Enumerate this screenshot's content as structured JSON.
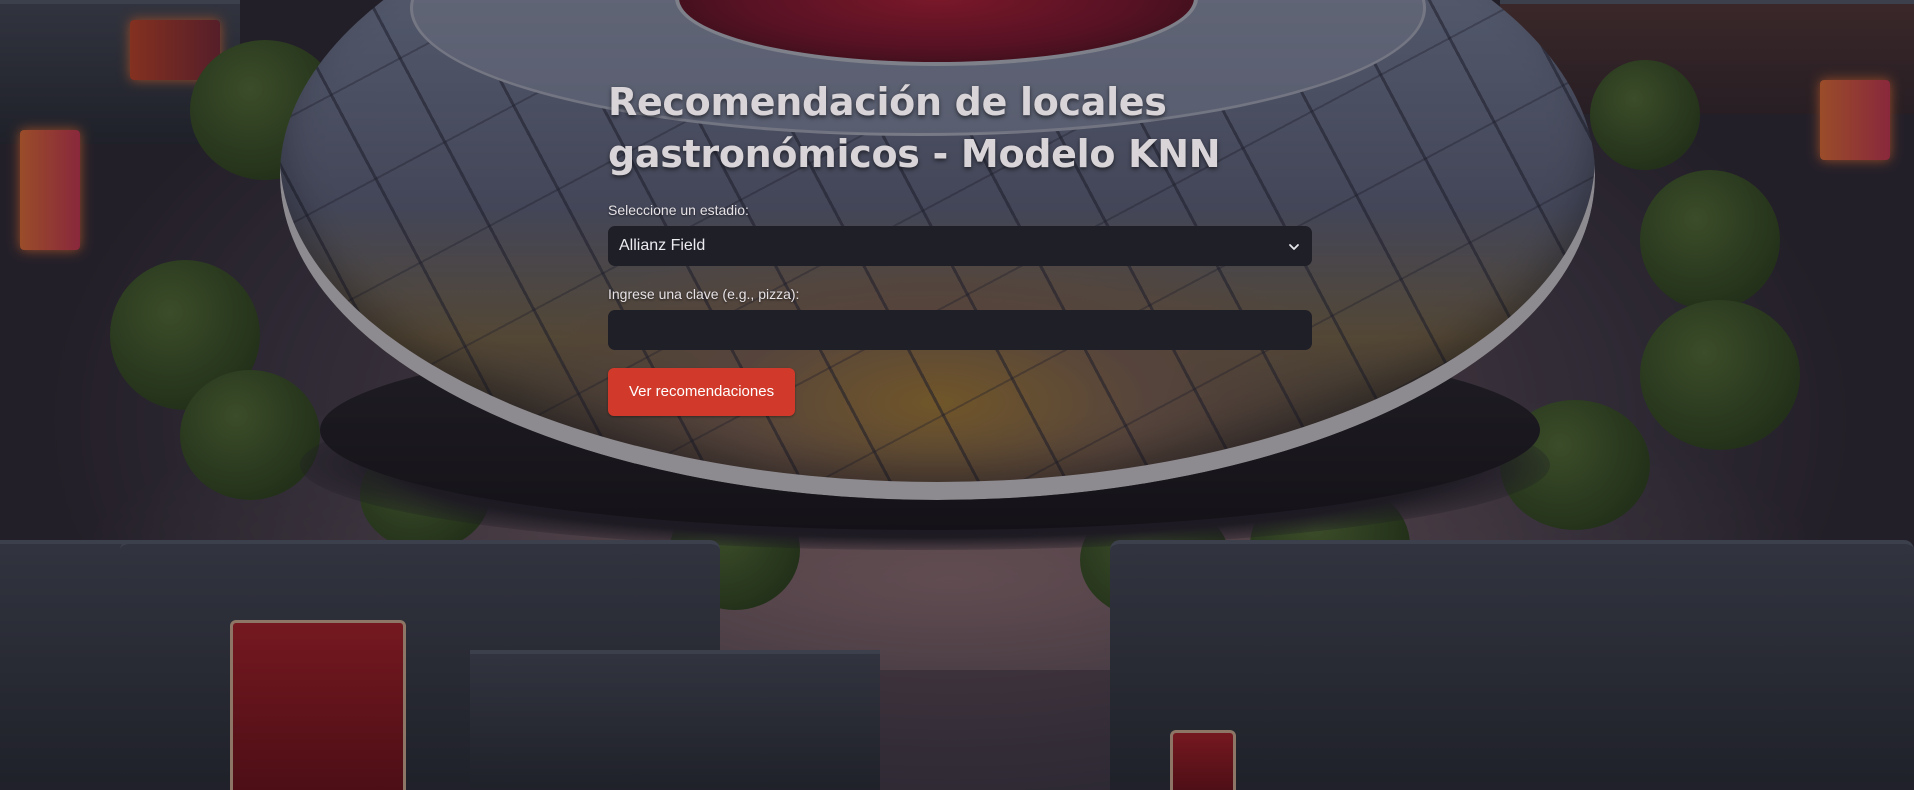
{
  "page": {
    "title": "Recomendación de locales gastronómicos - Modelo KNN"
  },
  "form": {
    "stadium_label": "Seleccione un estadio:",
    "stadium_selected": "Allianz Field",
    "keyword_label": "Ingrese una clave (e.g., pizza):",
    "keyword_value": "",
    "submit_label": "Ver recomendaciones"
  },
  "colors": {
    "button_accent": "#d13a2a",
    "input_background": "#1f1f28",
    "title_text": "#d9d4d8"
  },
  "icons": {
    "select_chevron": "chevron-down-icon",
    "background": "stadium-background-image"
  }
}
